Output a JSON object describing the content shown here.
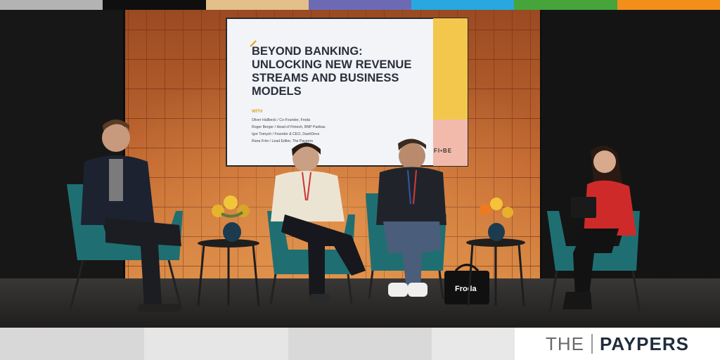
{
  "top_stripes": [
    "#b3b3b3",
    "#0f0f10",
    "#e3bf8a",
    "#6d6ab5",
    "#28a8e0",
    "#45a53a",
    "#f28f1a"
  ],
  "bottom_segments": [
    "#d8d8d8",
    "#e6e6e6",
    "#d9d9d9",
    "#e8e8e8",
    "#d6d6d6"
  ],
  "screen": {
    "title_lines": [
      "BEYOND BANKING:",
      "UNLOCKING NEW REVENUE",
      "STREAMS AND BUSINESS",
      "MODELS"
    ],
    "with_label": "WITH",
    "speakers": [
      "Oliver Hallbeck / Co-Founder, Froda",
      "Roger Berger / Head of Fintech, BNP Paribas",
      "Igor Tomych / Founder & CEO, DashDevs",
      "Rana Frim / Lead Editor, The Paypers"
    ],
    "event_logo": "FI•BE"
  },
  "stage_bag_label": "Froda",
  "brand": {
    "the": "THE",
    "paypers": "PAYPERS"
  }
}
